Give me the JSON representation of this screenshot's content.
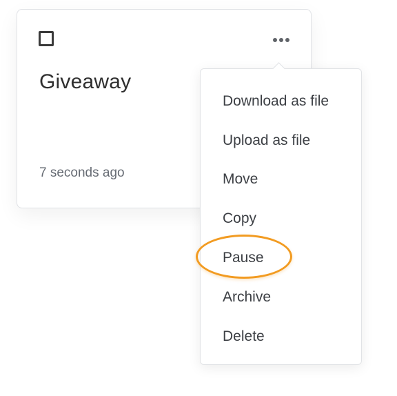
{
  "card": {
    "title": "Giveaway",
    "timestamp": "7 seconds ago",
    "checkbox_checked": false,
    "more_icon": "ellipsis-horizontal-icon"
  },
  "menu": {
    "items": [
      {
        "label": "Download as file"
      },
      {
        "label": "Upload as file"
      },
      {
        "label": "Move"
      },
      {
        "label": "Copy"
      },
      {
        "label": "Pause"
      },
      {
        "label": "Archive"
      },
      {
        "label": "Delete"
      }
    ],
    "highlighted_item": "Pause"
  },
  "colors": {
    "highlight": "#f29b21",
    "text_primary": "#2f2f2f",
    "text_secondary": "#666b73",
    "menu_text": "#3d4045"
  }
}
